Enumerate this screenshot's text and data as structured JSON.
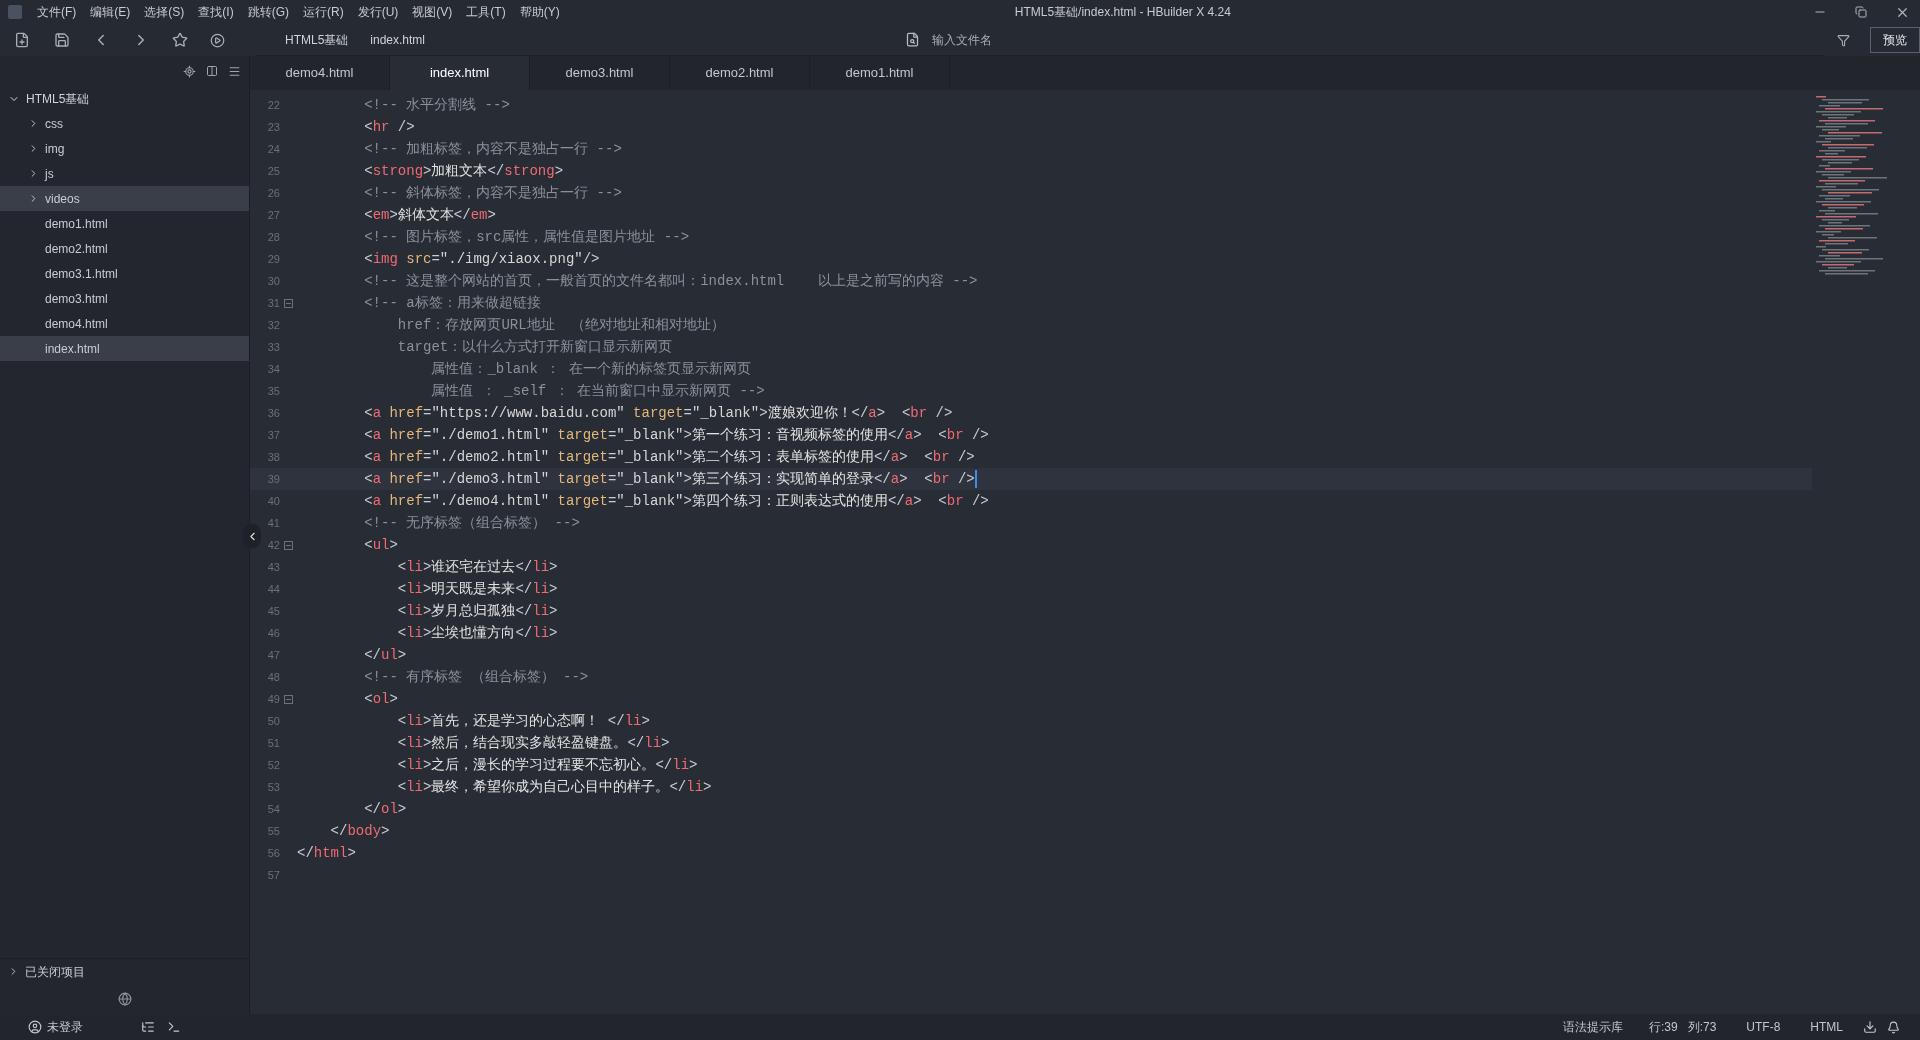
{
  "window": {
    "title": "HTML5基础/index.html - HBuilder X 4.24"
  },
  "menu": [
    "文件(F)",
    "编辑(E)",
    "选择(S)",
    "查找(I)",
    "跳转(G)",
    "运行(R)",
    "发行(U)",
    "视图(V)",
    "工具(T)",
    "帮助(Y)"
  ],
  "toolbar": {
    "breadcrumb": [
      "HTML5基础",
      "index.html"
    ],
    "search": {
      "placeholder": "输入文件名"
    },
    "preview_button": "预览"
  },
  "tabs": [
    {
      "label": "demo4.html",
      "selected": false
    },
    {
      "label": "index.html",
      "selected": true
    },
    {
      "label": "demo3.html",
      "selected": false
    },
    {
      "label": "demo2.html",
      "selected": false
    },
    {
      "label": "demo1.html",
      "selected": false
    }
  ],
  "sidebar": {
    "project": {
      "label": "HTML5基础",
      "expanded": true,
      "children": [
        {
          "label": "css",
          "kind": "folder",
          "expanded": false,
          "selected": false
        },
        {
          "label": "img",
          "kind": "folder",
          "expanded": false,
          "selected": false
        },
        {
          "label": "js",
          "kind": "folder",
          "expanded": false,
          "selected": false
        },
        {
          "label": "videos",
          "kind": "folder",
          "expanded": false,
          "selected": true
        },
        {
          "label": "demo1.html",
          "kind": "file",
          "selected": false
        },
        {
          "label": "demo2.html",
          "kind": "file",
          "selected": false
        },
        {
          "label": "demo3.1.html",
          "kind": "file",
          "selected": false
        },
        {
          "label": "demo3.html",
          "kind": "file",
          "selected": false
        },
        {
          "label": "demo4.html",
          "kind": "file",
          "selected": false
        },
        {
          "label": "index.html",
          "kind": "file",
          "selected": true
        }
      ]
    },
    "closed_projects": {
      "label": "已关闭项目",
      "expanded": false
    }
  },
  "editor": {
    "lines": [
      {
        "num": "22",
        "fold": false,
        "current": false,
        "tokens": [
          {
            "kind": "c",
            "text": "        <!-- 水平分割线 -->"
          }
        ]
      },
      {
        "num": "23",
        "fold": false,
        "current": false,
        "tokens": [
          {
            "kind": "p",
            "text": "        <"
          },
          {
            "kind": "t",
            "text": "hr"
          },
          {
            "kind": "p",
            "text": " />"
          }
        ]
      },
      {
        "num": "24",
        "fold": false,
        "current": false,
        "tokens": [
          {
            "kind": "c",
            "text": "        <!-- 加粗标签，内容不是独占一行 -->"
          }
        ]
      },
      {
        "num": "25",
        "fold": false,
        "current": false,
        "tokens": [
          {
            "kind": "p",
            "text": "        <"
          },
          {
            "kind": "t",
            "text": "strong"
          },
          {
            "kind": "p",
            "text": ">"
          },
          {
            "kind": "x",
            "text": "加粗文本"
          },
          {
            "kind": "p",
            "text": "</"
          },
          {
            "kind": "t",
            "text": "strong"
          },
          {
            "kind": "p",
            "text": ">"
          }
        ]
      },
      {
        "num": "26",
        "fold": false,
        "current": false,
        "tokens": [
          {
            "kind": "c",
            "text": "        <!-- 斜体标签，内容不是独占一行 -->"
          }
        ]
      },
      {
        "num": "27",
        "fold": false,
        "current": false,
        "tokens": [
          {
            "kind": "p",
            "text": "        <"
          },
          {
            "kind": "t",
            "text": "em"
          },
          {
            "kind": "p",
            "text": ">"
          },
          {
            "kind": "x",
            "text": "斜体文本"
          },
          {
            "kind": "p",
            "text": "</"
          },
          {
            "kind": "t",
            "text": "em"
          },
          {
            "kind": "p",
            "text": ">"
          }
        ]
      },
      {
        "num": "28",
        "fold": false,
        "current": false,
        "tokens": [
          {
            "kind": "c",
            "text": "        <!-- 图片标签，src属性，属性值是图片地址 -->"
          }
        ]
      },
      {
        "num": "29",
        "fold": false,
        "current": false,
        "tokens": [
          {
            "kind": "p",
            "text": "        <"
          },
          {
            "kind": "t",
            "text": "img"
          },
          {
            "kind": "a",
            "text": " src"
          },
          {
            "kind": "p",
            "text": "="
          },
          {
            "kind": "s",
            "text": "\"./img/xiaox.png\""
          },
          {
            "kind": "p",
            "text": "/>"
          }
        ]
      },
      {
        "num": "30",
        "fold": false,
        "current": false,
        "tokens": [
          {
            "kind": "c",
            "text": "        <!-- 这是整个网站的首页，一般首页的文件名都叫：index.html    以上是之前写的内容 -->"
          }
        ]
      },
      {
        "num": "31",
        "fold": true,
        "current": false,
        "tokens": [
          {
            "kind": "c",
            "text": "        <!-- a标签：用来做超链接"
          }
        ]
      },
      {
        "num": "32",
        "fold": false,
        "current": false,
        "tokens": [
          {
            "kind": "c",
            "text": "            href：存放网页URL地址  （绝对地址和相对地址）"
          }
        ]
      },
      {
        "num": "33",
        "fold": false,
        "current": false,
        "tokens": [
          {
            "kind": "c",
            "text": "            target：以什么方式打开新窗口显示新网页"
          }
        ]
      },
      {
        "num": "34",
        "fold": false,
        "current": false,
        "tokens": [
          {
            "kind": "c",
            "text": "                属性值：_blank ： 在一个新的标签页显示新网页"
          }
        ]
      },
      {
        "num": "35",
        "fold": false,
        "current": false,
        "tokens": [
          {
            "kind": "c",
            "text": "                属性值 ： _self ： 在当前窗口中显示新网页 -->"
          }
        ]
      },
      {
        "num": "36",
        "fold": false,
        "current": false,
        "tokens": [
          {
            "kind": "p",
            "text": "        <"
          },
          {
            "kind": "t",
            "text": "a"
          },
          {
            "kind": "a",
            "text": " href"
          },
          {
            "kind": "p",
            "text": "="
          },
          {
            "kind": "s",
            "text": "\"https://www.baidu.com\""
          },
          {
            "kind": "a",
            "text": " target"
          },
          {
            "kind": "p",
            "text": "="
          },
          {
            "kind": "s",
            "text": "\"_blank\""
          },
          {
            "kind": "p",
            "text": ">"
          },
          {
            "kind": "x",
            "text": "渡娘欢迎你！"
          },
          {
            "kind": "p",
            "text": "</"
          },
          {
            "kind": "t",
            "text": "a"
          },
          {
            "kind": "p",
            "text": ">  <"
          },
          {
            "kind": "t",
            "text": "br"
          },
          {
            "kind": "p",
            "text": " />"
          }
        ]
      },
      {
        "num": "37",
        "fold": false,
        "current": false,
        "tokens": [
          {
            "kind": "p",
            "text": "        <"
          },
          {
            "kind": "t",
            "text": "a"
          },
          {
            "kind": "a",
            "text": " href"
          },
          {
            "kind": "p",
            "text": "="
          },
          {
            "kind": "s",
            "text": "\"./demo1.html\""
          },
          {
            "kind": "a",
            "text": " target"
          },
          {
            "kind": "p",
            "text": "="
          },
          {
            "kind": "s",
            "text": "\"_blank\""
          },
          {
            "kind": "p",
            "text": ">"
          },
          {
            "kind": "x",
            "text": "第一个练习：音视频标签的使用"
          },
          {
            "kind": "p",
            "text": "</"
          },
          {
            "kind": "t",
            "text": "a"
          },
          {
            "kind": "p",
            "text": ">  <"
          },
          {
            "kind": "t",
            "text": "br"
          },
          {
            "kind": "p",
            "text": " />"
          }
        ]
      },
      {
        "num": "38",
        "fold": false,
        "current": false,
        "tokens": [
          {
            "kind": "p",
            "text": "        <"
          },
          {
            "kind": "t",
            "text": "a"
          },
          {
            "kind": "a",
            "text": " href"
          },
          {
            "kind": "p",
            "text": "="
          },
          {
            "kind": "s",
            "text": "\"./demo2.html\""
          },
          {
            "kind": "a",
            "text": " target"
          },
          {
            "kind": "p",
            "text": "="
          },
          {
            "kind": "s",
            "text": "\"_blank\""
          },
          {
            "kind": "p",
            "text": ">"
          },
          {
            "kind": "x",
            "text": "第二个练习：表单标签的使用"
          },
          {
            "kind": "p",
            "text": "</"
          },
          {
            "kind": "t",
            "text": "a"
          },
          {
            "kind": "p",
            "text": ">  <"
          },
          {
            "kind": "t",
            "text": "br"
          },
          {
            "kind": "p",
            "text": " />"
          }
        ]
      },
      {
        "num": "39",
        "fold": false,
        "current": true,
        "tokens": [
          {
            "kind": "p",
            "text": "        <"
          },
          {
            "kind": "t",
            "text": "a"
          },
          {
            "kind": "a",
            "text": " href"
          },
          {
            "kind": "p",
            "text": "="
          },
          {
            "kind": "s",
            "text": "\"./demo3.html\""
          },
          {
            "kind": "a",
            "text": " target"
          },
          {
            "kind": "p",
            "text": "="
          },
          {
            "kind": "s",
            "text": "\"_blank\""
          },
          {
            "kind": "p",
            "text": ">"
          },
          {
            "kind": "x",
            "text": "第三个练习：实现简单的登录"
          },
          {
            "kind": "p",
            "text": "</"
          },
          {
            "kind": "t",
            "text": "a"
          },
          {
            "kind": "p",
            "text": ">  <"
          },
          {
            "kind": "t",
            "text": "br"
          },
          {
            "kind": "p",
            "text": " />"
          }
        ]
      },
      {
        "num": "40",
        "fold": false,
        "current": false,
        "tokens": [
          {
            "kind": "p",
            "text": "        <"
          },
          {
            "kind": "t",
            "text": "a"
          },
          {
            "kind": "a",
            "text": " href"
          },
          {
            "kind": "p",
            "text": "="
          },
          {
            "kind": "s",
            "text": "\"./demo4.html\""
          },
          {
            "kind": "a",
            "text": " target"
          },
          {
            "kind": "p",
            "text": "="
          },
          {
            "kind": "s",
            "text": "\"_blank\""
          },
          {
            "kind": "p",
            "text": ">"
          },
          {
            "kind": "x",
            "text": "第四个练习：正则表达式的使用"
          },
          {
            "kind": "p",
            "text": "</"
          },
          {
            "kind": "t",
            "text": "a"
          },
          {
            "kind": "p",
            "text": ">  <"
          },
          {
            "kind": "t",
            "text": "br"
          },
          {
            "kind": "p",
            "text": " />"
          }
        ]
      },
      {
        "num": "41",
        "fold": false,
        "current": false,
        "tokens": [
          {
            "kind": "c",
            "text": "        <!-- 无序标签（组合标签） -->"
          }
        ]
      },
      {
        "num": "42",
        "fold": true,
        "current": false,
        "tokens": [
          {
            "kind": "p",
            "text": "        <"
          },
          {
            "kind": "t",
            "text": "ul"
          },
          {
            "kind": "p",
            "text": ">"
          }
        ]
      },
      {
        "num": "43",
        "fold": false,
        "current": false,
        "tokens": [
          {
            "kind": "p",
            "text": "            <"
          },
          {
            "kind": "t",
            "text": "li"
          },
          {
            "kind": "p",
            "text": ">"
          },
          {
            "kind": "x",
            "text": "谁还宅在过去"
          },
          {
            "kind": "p",
            "text": "</"
          },
          {
            "kind": "t",
            "text": "li"
          },
          {
            "kind": "p",
            "text": ">"
          }
        ]
      },
      {
        "num": "44",
        "fold": false,
        "current": false,
        "tokens": [
          {
            "kind": "p",
            "text": "            <"
          },
          {
            "kind": "t",
            "text": "li"
          },
          {
            "kind": "p",
            "text": ">"
          },
          {
            "kind": "x",
            "text": "明天既是未来"
          },
          {
            "kind": "p",
            "text": "</"
          },
          {
            "kind": "t",
            "text": "li"
          },
          {
            "kind": "p",
            "text": ">"
          }
        ]
      },
      {
        "num": "45",
        "fold": false,
        "current": false,
        "tokens": [
          {
            "kind": "p",
            "text": "            <"
          },
          {
            "kind": "t",
            "text": "li"
          },
          {
            "kind": "p",
            "text": ">"
          },
          {
            "kind": "x",
            "text": "岁月总归孤独"
          },
          {
            "kind": "p",
            "text": "</"
          },
          {
            "kind": "t",
            "text": "li"
          },
          {
            "kind": "p",
            "text": ">"
          }
        ]
      },
      {
        "num": "46",
        "fold": false,
        "current": false,
        "tokens": [
          {
            "kind": "p",
            "text": "            <"
          },
          {
            "kind": "t",
            "text": "li"
          },
          {
            "kind": "p",
            "text": ">"
          },
          {
            "kind": "x",
            "text": "尘埃也懂方向"
          },
          {
            "kind": "p",
            "text": "</"
          },
          {
            "kind": "t",
            "text": "li"
          },
          {
            "kind": "p",
            "text": ">"
          }
        ]
      },
      {
        "num": "47",
        "fold": false,
        "current": false,
        "tokens": [
          {
            "kind": "p",
            "text": "        </"
          },
          {
            "kind": "t",
            "text": "ul"
          },
          {
            "kind": "p",
            "text": ">"
          }
        ]
      },
      {
        "num": "48",
        "fold": false,
        "current": false,
        "tokens": [
          {
            "kind": "c",
            "text": "        <!-- 有序标签 （组合标签） -->"
          }
        ]
      },
      {
        "num": "49",
        "fold": true,
        "current": false,
        "tokens": [
          {
            "kind": "p",
            "text": "        <"
          },
          {
            "kind": "t",
            "text": "ol"
          },
          {
            "kind": "p",
            "text": ">"
          }
        ]
      },
      {
        "num": "50",
        "fold": false,
        "current": false,
        "tokens": [
          {
            "kind": "p",
            "text": "            <"
          },
          {
            "kind": "t",
            "text": "li"
          },
          {
            "kind": "p",
            "text": ">"
          },
          {
            "kind": "x",
            "text": "首先，还是学习的心态啊！"
          },
          {
            "kind": "p",
            "text": " </"
          },
          {
            "kind": "t",
            "text": "li"
          },
          {
            "kind": "p",
            "text": ">"
          }
        ]
      },
      {
        "num": "51",
        "fold": false,
        "current": false,
        "tokens": [
          {
            "kind": "p",
            "text": "            <"
          },
          {
            "kind": "t",
            "text": "li"
          },
          {
            "kind": "p",
            "text": ">"
          },
          {
            "kind": "x",
            "text": "然后，结合现实多敲轻盈键盘。"
          },
          {
            "kind": "p",
            "text": "</"
          },
          {
            "kind": "t",
            "text": "li"
          },
          {
            "kind": "p",
            "text": ">"
          }
        ]
      },
      {
        "num": "52",
        "fold": false,
        "current": false,
        "tokens": [
          {
            "kind": "p",
            "text": "            <"
          },
          {
            "kind": "t",
            "text": "li"
          },
          {
            "kind": "p",
            "text": ">"
          },
          {
            "kind": "x",
            "text": "之后，漫长的学习过程要不忘初心。"
          },
          {
            "kind": "p",
            "text": "</"
          },
          {
            "kind": "t",
            "text": "li"
          },
          {
            "kind": "p",
            "text": ">"
          }
        ]
      },
      {
        "num": "53",
        "fold": false,
        "current": false,
        "tokens": [
          {
            "kind": "p",
            "text": "            <"
          },
          {
            "kind": "t",
            "text": "li"
          },
          {
            "kind": "p",
            "text": ">"
          },
          {
            "kind": "x",
            "text": "最终，希望你成为自己心目中的样子。"
          },
          {
            "kind": "p",
            "text": "</"
          },
          {
            "kind": "t",
            "text": "li"
          },
          {
            "kind": "p",
            "text": ">"
          }
        ]
      },
      {
        "num": "54",
        "fold": false,
        "current": false,
        "tokens": [
          {
            "kind": "p",
            "text": "        </"
          },
          {
            "kind": "t",
            "text": "ol"
          },
          {
            "kind": "p",
            "text": ">"
          }
        ]
      },
      {
        "num": "55",
        "fold": false,
        "current": false,
        "tokens": [
          {
            "kind": "p",
            "text": "    </"
          },
          {
            "kind": "t",
            "text": "body"
          },
          {
            "kind": "p",
            "text": ">"
          }
        ]
      },
      {
        "num": "56",
        "fold": false,
        "current": false,
        "tokens": [
          {
            "kind": "p",
            "text": "</"
          },
          {
            "kind": "t",
            "text": "html"
          },
          {
            "kind": "p",
            "text": ">"
          }
        ]
      },
      {
        "num": "57",
        "fold": false,
        "current": false
      }
    ]
  },
  "status_bar": {
    "login": "未登录",
    "syntax_library": "语法提示库",
    "line": "行:39",
    "column": "列:73",
    "encoding": "UTF-8",
    "language": "HTML"
  }
}
